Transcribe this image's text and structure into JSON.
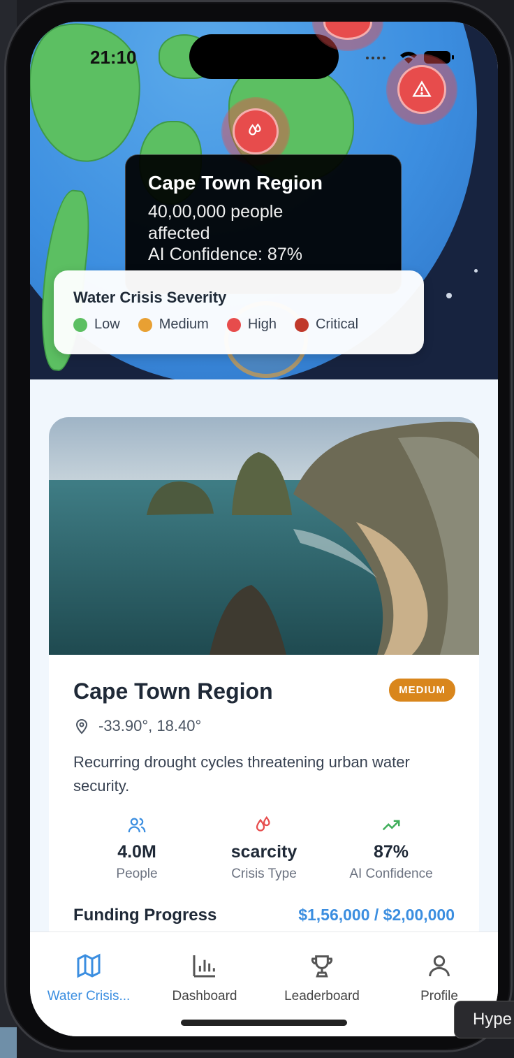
{
  "status_bar": {
    "time": "21:10"
  },
  "map": {
    "tooltip": {
      "title": "Cape Town Region",
      "people": "40,00,000 people affected",
      "confidence": "AI Confidence: 87%"
    },
    "legend": {
      "title": "Water Crisis Severity",
      "items": [
        {
          "label": "Low",
          "color": "#5cbf62"
        },
        {
          "label": "Medium",
          "color": "#e8a033"
        },
        {
          "label": "High",
          "color": "#e74c4c"
        },
        {
          "label": "Critical",
          "color": "#c0392b"
        }
      ]
    },
    "markers": [
      "drop-icon",
      "warning-icon"
    ]
  },
  "card": {
    "title": "Cape Town Region",
    "severity_badge": "MEDIUM",
    "coordinates": "-33.90°, 18.40°",
    "description": "Recurring drought cycles threatening urban water security.",
    "stats": [
      {
        "icon": "people-icon",
        "value": "4.0M",
        "label": "People"
      },
      {
        "icon": "drop-icon",
        "value": "scarcity",
        "label": "Crisis Type"
      },
      {
        "icon": "trending-up-icon",
        "value": "87%",
        "label": "AI Confidence"
      }
    ],
    "funding": {
      "label": "Funding Progress",
      "value": "$1,56,000 / $2,00,000"
    }
  },
  "tabs": [
    {
      "label": "Water Crisis...",
      "icon": "map-icon",
      "active": true
    },
    {
      "label": "Dashboard",
      "icon": "bar-chart-icon",
      "active": false
    },
    {
      "label": "Leaderboard",
      "icon": "trophy-icon",
      "active": false
    },
    {
      "label": "Profile",
      "icon": "user-icon",
      "active": false
    }
  ],
  "overlay": {
    "tooltip_text": "Hype"
  },
  "colors": {
    "accent": "#3b8ee0",
    "badge": "#d9861c",
    "marker": "#e74c4c"
  }
}
